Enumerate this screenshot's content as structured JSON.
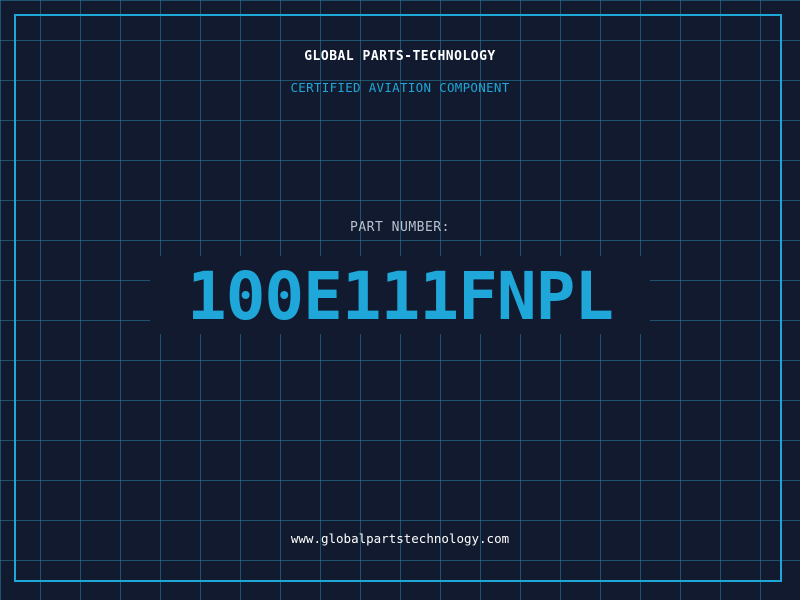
{
  "header": {
    "company": "GLOBAL PARTS-TECHNOLOGY",
    "tagline": "CERTIFIED AVIATION COMPONENT"
  },
  "part": {
    "label": "PART NUMBER:",
    "number": "100E111FNPL"
  },
  "footer": {
    "website": "www.globalpartstechnology.com"
  },
  "colors": {
    "background": "#111a2e",
    "accent": "#1ea7d8",
    "grid": "#28829f",
    "text": "#ffffff"
  }
}
